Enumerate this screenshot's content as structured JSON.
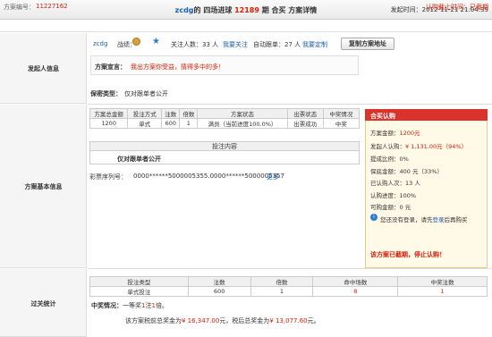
{
  "header": {
    "initiator": "zcdg",
    "title_mid": "的 四场进球 ",
    "issue": "12189",
    "title_tail": " 期 合买 方案详情",
    "time_label": "发起时间：",
    "time_value": "2012-11-21 21:04:39"
  },
  "plan_id": {
    "label": "方案编号：",
    "value": "11227162"
  },
  "deadline": "认购截止时间：已截期",
  "sections": {
    "initiator": "发起人信息",
    "basic": "方案基本信息",
    "stats": "过关统计"
  },
  "initiator": {
    "name": "zcdg",
    "record_label": "战绩：",
    "follow_label": "关注人数：33 人",
    "follow_link": "我要关注",
    "auto_label": "自动跟单：27 人",
    "auto_link": "我要定制",
    "copy_button": "复制方案地址",
    "declaration_label": "方案宣言：",
    "declaration_text": "我出方案你受益，猜得多中的多！",
    "privacy_label": "保密类型：",
    "privacy_value": "仅对跟单者公开"
  },
  "plan_table": {
    "headers": [
      "方案总金额",
      "投注方式",
      "注数",
      "倍数",
      "方案状态",
      "出票状态",
      "中奖情况"
    ],
    "row": [
      "1200",
      "单式",
      "600",
      "1",
      "满员（当前进度100.0%）",
      "出票成功",
      "中奖"
    ]
  },
  "content": {
    "header": "投注内容",
    "text": "仅对跟单者公开",
    "lottery_label": "彩票序列号：",
    "lottery_value": "0000******5000005355.0000******5000005357",
    "more": "更多"
  },
  "side_panel": {
    "title": "合买认购",
    "total_label": "方案金额：",
    "total_value": "1200元",
    "initiator_label": "发起人认购：",
    "initiator_value": "¥ 1,131.00元（94%）",
    "commission": "提成比例：0%",
    "guarantee": "保底金额：400 元（33%）",
    "buyers": "已认购人次：13 人",
    "progress_label": "认购进度：",
    "progress_value": "100%",
    "available": "可购金额：0 元",
    "login_prefix": "您还没有登录，请先",
    "login_link": "登录",
    "login_suffix": "后再购买",
    "expired": "该方案已截期，停止认购！"
  },
  "stats_table": {
    "headers": [
      "投注类型",
      "注数",
      "倍数",
      "命中场数",
      "中奖注数"
    ],
    "row": [
      "单式投注",
      "600",
      "1",
      "8",
      "1"
    ]
  },
  "win_info": {
    "label": "中奖情况：",
    "prefix": "一等奖",
    "count": "1",
    "mid": "注",
    "times": "1",
    "suffix": "倍。"
  },
  "bonus": {
    "pre_label": "该方案税前总奖金为",
    "pre_value": "¥ 16,347.00",
    "post_label": "元，税后总奖金为",
    "post_value": "¥ 13,077.60",
    "unit": "元。"
  },
  "colors": {
    "accent_red": "#d81e06",
    "link_blue": "#1f5fb0",
    "panel_head": "#d9332b"
  }
}
